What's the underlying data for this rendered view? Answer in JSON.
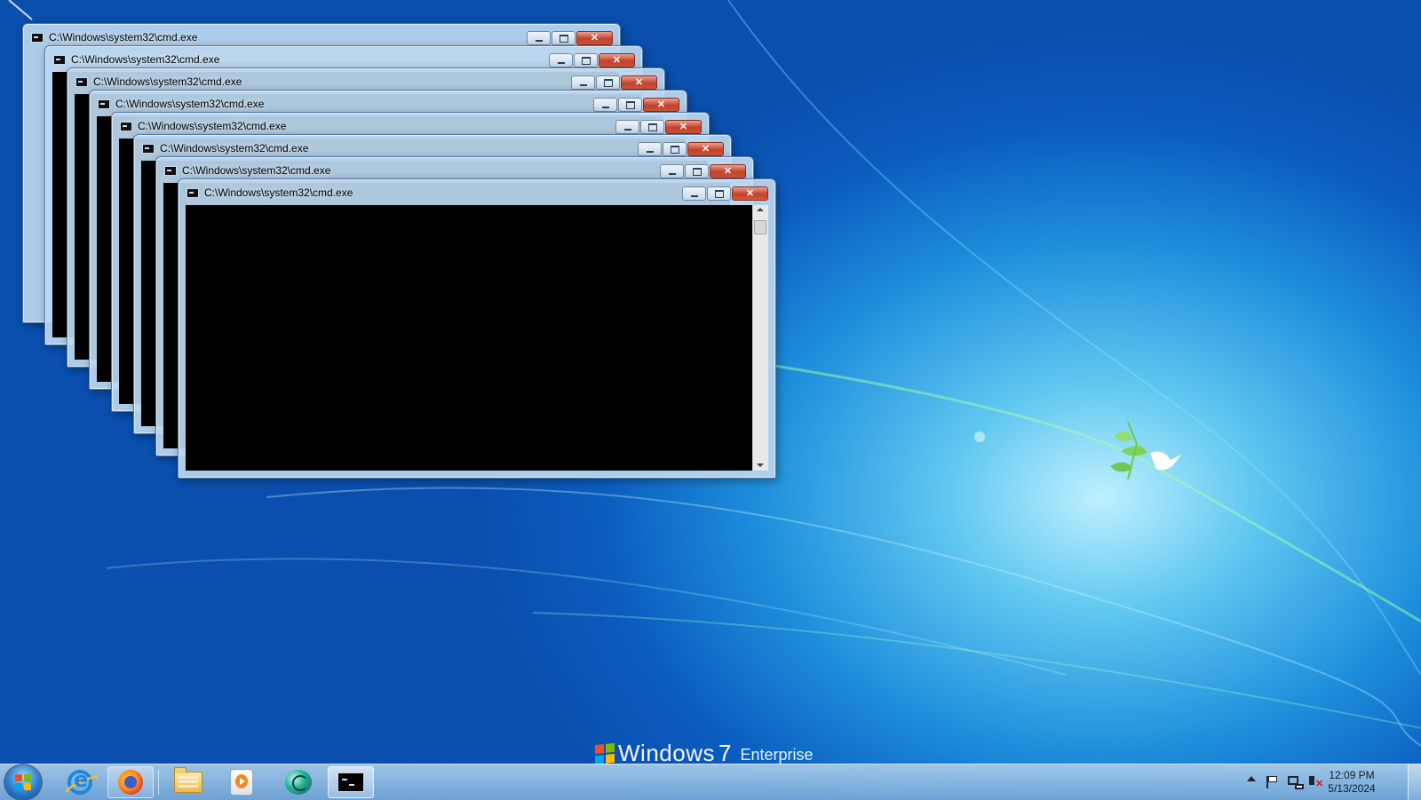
{
  "desktop": {
    "branding": {
      "name": "Windows",
      "version": "7",
      "edition": "Enterprise"
    },
    "colors": {
      "wallpaper_deep": "#0a4fae",
      "wallpaper_glow": "#bff0ff",
      "logo_red": "#f25022",
      "logo_green": "#7fba00",
      "logo_blue": "#00a4ef",
      "logo_yellow": "#ffb900"
    }
  },
  "windows": [
    {
      "title": "C:\\Windows\\system32\\cmd.exe",
      "content": "ghost",
      "icon": "cmd-icon",
      "buttons": [
        "minimize",
        "maximize",
        "close"
      ]
    },
    {
      "title": "C:\\Windows\\system32\\cmd.exe",
      "content": "console",
      "icon": "cmd-icon",
      "buttons": [
        "minimize",
        "maximize",
        "close"
      ]
    },
    {
      "title": "C:\\Windows\\system32\\cmd.exe",
      "content": "console",
      "icon": "cmd-icon",
      "buttons": [
        "minimize",
        "maximize",
        "close"
      ]
    },
    {
      "title": "C:\\Windows\\system32\\cmd.exe",
      "content": "console",
      "icon": "cmd-icon",
      "buttons": [
        "minimize",
        "maximize",
        "close"
      ]
    },
    {
      "title": "C:\\Windows\\system32\\cmd.exe",
      "content": "console",
      "icon": "cmd-icon",
      "buttons": [
        "minimize",
        "maximize",
        "close"
      ]
    },
    {
      "title": "C:\\Windows\\system32\\cmd.exe",
      "content": "console",
      "icon": "cmd-icon",
      "buttons": [
        "minimize",
        "maximize",
        "close"
      ]
    },
    {
      "title": "C:\\Windows\\system32\\cmd.exe",
      "content": "console",
      "icon": "cmd-icon",
      "buttons": [
        "minimize",
        "maximize",
        "close"
      ]
    },
    {
      "title": "C:\\Windows\\system32\\cmd.exe",
      "content": "console",
      "icon": "cmd-icon",
      "buttons": [
        "minimize",
        "maximize",
        "close"
      ]
    }
  ],
  "taskbar": {
    "start_icon": "windows-start-orb",
    "items": [
      {
        "name": "internet-explorer",
        "icon": "ie-icon",
        "state": "pinned"
      },
      {
        "name": "firefox",
        "icon": "firefox-icon",
        "state": "running"
      },
      {
        "name": "windows-explorer",
        "icon": "folder-icon",
        "state": "pinned"
      },
      {
        "name": "windows-media-player",
        "icon": "media-player-icon",
        "state": "pinned"
      },
      {
        "name": "app-orb",
        "icon": "green-orb-icon",
        "state": "pinned"
      },
      {
        "name": "command-prompt",
        "icon": "cmd-icon",
        "state": "active"
      }
    ],
    "tray": {
      "icons": [
        "show-hidden-icons-arrow",
        "action-center-flag-icon",
        "network-icon",
        "volume-muted-icon"
      ],
      "time": "12:09 PM",
      "date": "5/13/2024"
    }
  }
}
